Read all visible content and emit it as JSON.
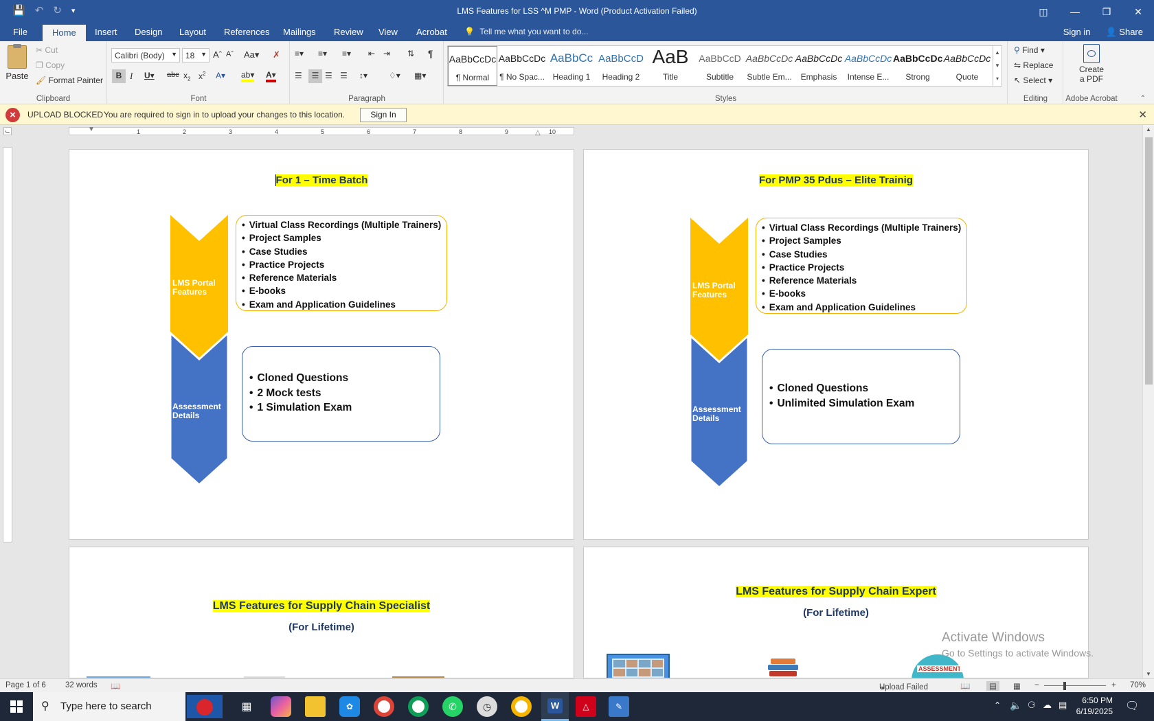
{
  "window": {
    "title": "LMS Features for LSS ^M PMP - Word (Product Activation Failed)"
  },
  "tabs": [
    "File",
    "Home",
    "Insert",
    "Design",
    "Layout",
    "References",
    "Mailings",
    "Review",
    "View",
    "Acrobat"
  ],
  "tell_me": "Tell me what you want to do...",
  "account": {
    "sign_in": "Sign in",
    "share": "Share"
  },
  "ribbon": {
    "clipboard": {
      "paste": "Paste",
      "cut": "Cut",
      "copy": "Copy",
      "format_painter": "Format Painter",
      "label": "Clipboard"
    },
    "font": {
      "name": "Calibri (Body)",
      "size": "18",
      "label": "Font"
    },
    "paragraph": {
      "label": "Paragraph"
    },
    "styles": {
      "label": "Styles",
      "items": [
        {
          "sample": "AaBbCcDc",
          "name": "¶ Normal"
        },
        {
          "sample": "AaBbCcDc",
          "name": "¶ No Spac..."
        },
        {
          "sample": "AaBbCc",
          "name": "Heading 1"
        },
        {
          "sample": "AaBbCcD",
          "name": "Heading 2"
        },
        {
          "sample": "AaB",
          "name": "Title"
        },
        {
          "sample": "AaBbCcD",
          "name": "Subtitle"
        },
        {
          "sample": "AaBbCcDc",
          "name": "Subtle Em..."
        },
        {
          "sample": "AaBbCcDc",
          "name": "Emphasis"
        },
        {
          "sample": "AaBbCcDc",
          "name": "Intense E..."
        },
        {
          "sample": "AaBbCcDc",
          "name": "Strong"
        },
        {
          "sample": "AaBbCcDc",
          "name": "Quote"
        }
      ]
    },
    "editing": {
      "find": "Find",
      "replace": "Replace",
      "select": "Select",
      "label": "Editing"
    },
    "acrobat": {
      "create": "Create",
      "pdf": "a PDF",
      "label": "Adobe Acrobat"
    }
  },
  "message_bar": {
    "heading": "UPLOAD BLOCKED",
    "text": "You are required to sign in to upload your changes to this location.",
    "button": "Sign In"
  },
  "ruler_numbers": [
    "1",
    "2",
    "3",
    "4",
    "5",
    "6",
    "7",
    "8",
    "9",
    "10"
  ],
  "pages": [
    {
      "title": "For 1 – Time Batch",
      "chevron_top": "LMS Portal Features",
      "chevron_bottom": "Assessment Details",
      "features": [
        "Virtual Class Recordings (Multiple Trainers)",
        "Project Samples",
        "Case Studies",
        "Practice Projects",
        "Reference Materials",
        "E-books",
        "Exam and Application Guidelines"
      ],
      "assessment": [
        "Cloned Questions",
        "2 Mock tests",
        "1  Simulation Exam"
      ]
    },
    {
      "title": "For PMP 35 Pdus – Elite Trainig",
      "chevron_top": "LMS Portal Features",
      "chevron_bottom": "Assessment Details",
      "features": [
        "Virtual Class Recordings (Multiple Trainers)",
        "Project Samples",
        "Case Studies",
        "Practice Projects",
        "Reference Materials",
        "E-books",
        "Exam and Application Guidelines"
      ],
      "assessment": [
        "Cloned Questions",
        "Unlimited  Simulation Exam"
      ]
    },
    {
      "title": "LMS Features for Supply Chain Specialist",
      "subtitle": "(For Lifetime)"
    },
    {
      "title": "LMS Features for Supply Chain Expert",
      "subtitle": "(For Lifetime)"
    }
  ],
  "watermark": {
    "line1": "Activate Windows",
    "line2": "Go to Settings to activate Windows."
  },
  "status": {
    "page": "Page 1 of 6",
    "words": "32 words",
    "upload": "Upload Failed",
    "zoom": "70%"
  },
  "taskbar": {
    "search_placeholder": "Type here to search",
    "time": "6:50 PM",
    "date": "6/19/2025"
  },
  "colors": {
    "word_blue": "#2b579a",
    "chevron_yellow": "#ffc000",
    "chevron_blue": "#4472c4",
    "highlight": "#ffff00"
  }
}
